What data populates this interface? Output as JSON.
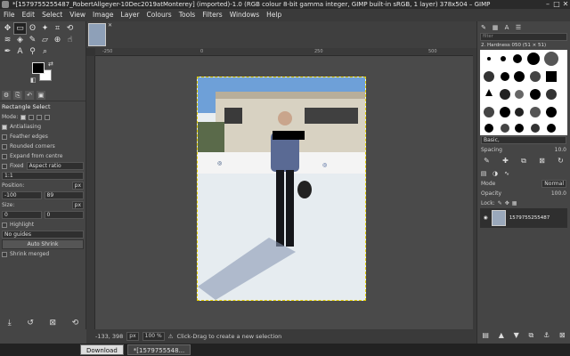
{
  "window": {
    "title": "*[1579755255487_RobertAllgeyer-10Dec2019atMonterey] (imported)-1.0 (RGB colour 8-bit gamma integer, GIMP built-in sRGB, 1 layer) 378x504 – GIMP"
  },
  "menu": [
    "File",
    "Edit",
    "Select",
    "View",
    "Image",
    "Layer",
    "Colours",
    "Tools",
    "Filters",
    "Windows",
    "Help"
  ],
  "tool_options": {
    "title": "Rectangle Select",
    "mode_label": "Mode:",
    "antialiasing": "Antialiasing",
    "feather": "Feather edges",
    "rounded": "Rounded corners",
    "expand": "Expand from centre",
    "fixed": "Fixed",
    "aspect": "Aspect ratio",
    "ratio": "1:1",
    "position_label": "Position:",
    "pos_unit": "px",
    "pos_x": "-100",
    "pos_y": "89",
    "size_label": "Size:",
    "size_unit": "px",
    "size_w": "0",
    "size_h": "0",
    "highlight": "Highlight",
    "guides": "No guides",
    "auto_shrink": "Auto Shrink",
    "shrink_merged": "Shrink merged"
  },
  "ruler_ticks": [
    "-250",
    "0",
    "250",
    "500"
  ],
  "status": {
    "coords": "-133, 398",
    "unit": "px",
    "zoom": "100 %",
    "hint": "Click-Drag to create a new selection"
  },
  "brushes": {
    "filter_placeholder": "filter",
    "selected": "2. Hardness 050 (51 × 51)",
    "preset": "Basic,",
    "spacing_label": "Spacing",
    "spacing_value": "10.0"
  },
  "layers": {
    "mode_label": "Mode",
    "mode_value": "Normal",
    "opacity_label": "Opacity",
    "opacity_value": "100.0",
    "lock_label": "Lock:",
    "layer_name": "1579755255487"
  },
  "taskbar": {
    "download": "Download",
    "gimp": "*[1579755548..."
  }
}
